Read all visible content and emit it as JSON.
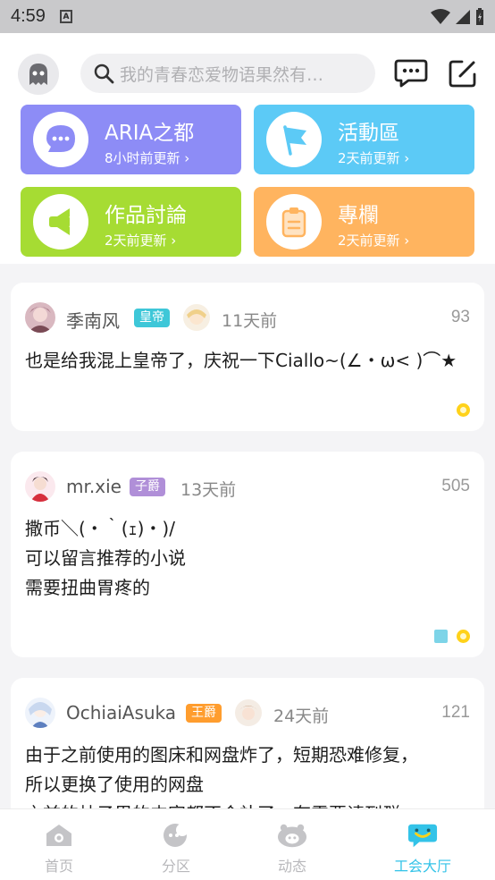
{
  "status_bar": {
    "time": "4:59",
    "sim_label": "A"
  },
  "header": {
    "search_placeholder": "我的青春恋爱物语果然有…"
  },
  "tiles": [
    {
      "title": "ARIA之都",
      "subtitle": "8小时前更新 ›",
      "color": "#8d8cf6",
      "icon": "chat-bubble-icon"
    },
    {
      "title": "活動區",
      "subtitle": "2天前更新 ›",
      "color": "#5ccaf6",
      "icon": "flag-icon"
    },
    {
      "title": "作品討論",
      "subtitle": "2天前更新 ›",
      "color": "#a6dc33",
      "icon": "megaphone-icon"
    },
    {
      "title": "專欄",
      "subtitle": "2天前更新 ›",
      "color": "#ffb45f",
      "icon": "clipboard-icon"
    }
  ],
  "posts": [
    {
      "username": "季南风",
      "badge": "皇帝",
      "badge_color": "#3ec7d8",
      "time": "11天前",
      "count": "93",
      "lines": [
        "也是给我混上皇帝了，庆祝一下Ciallo~(∠・ω< )⌒★"
      ]
    },
    {
      "username": "mr.xie",
      "badge": "子爵",
      "badge_color": "#b08fd8",
      "time": "13天前",
      "count": "505",
      "lines": [
        "撒币＼(・｀(ｪ)・)/",
        "可以留言推荐的小说",
        "需要扭曲胃疼的"
      ]
    },
    {
      "username": "OchiaiAsuka",
      "badge": "王爵",
      "badge_color": "#ff9d2e",
      "time": "24天前",
      "count": "121",
      "lines": [
        "由于之前使用的图床和网盘炸了，短期恐难修复，",
        "所以更换了使用的网盘",
        "之前的帖子里的内容都不会补了，有需要请到群..."
      ]
    }
  ],
  "bottom_nav": [
    {
      "label": "首页",
      "icon": "home-icon",
      "active": false
    },
    {
      "label": "分区",
      "icon": "moon-icon",
      "active": false
    },
    {
      "label": "动态",
      "icon": "face-icon",
      "active": false
    },
    {
      "label": "工会大厅",
      "icon": "guild-chat-icon",
      "active": true
    }
  ]
}
